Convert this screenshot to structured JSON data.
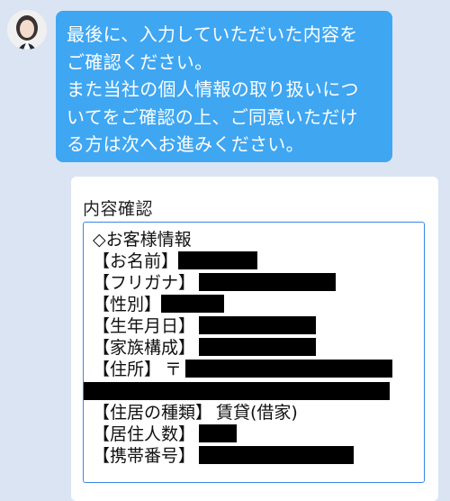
{
  "message": {
    "lines": [
      "最後に、入力していただいた内容を",
      "ご確認ください。",
      "また当社の個人情報の取り扱いにつ",
      "いてをご確認の上、ご同意いただけ",
      "る方は次へお進みください。"
    ]
  },
  "card": {
    "title": "内容確認",
    "section_header": "◇お客様情報",
    "fields": [
      {
        "label": "【お名前】",
        "value": ""
      },
      {
        "label": "【フリガナ】",
        "value": ""
      },
      {
        "label": "【性別】",
        "value": ""
      },
      {
        "label": "【生年月日】",
        "value": ""
      },
      {
        "label": "【家族構成】",
        "value": ""
      },
      {
        "label": "【住所】",
        "value": "〒"
      },
      {
        "label": "【住居の種類】",
        "value": "賃貸(借家)"
      },
      {
        "label": "【居住人数】",
        "value": ""
      },
      {
        "label": "【携帯番号】",
        "value": ""
      }
    ]
  },
  "colors": {
    "background": "#dbe4f3",
    "bubble": "#3fa6f2",
    "card": "#ffffff",
    "focus_border": "#3a86e6",
    "redaction": "#000000"
  }
}
